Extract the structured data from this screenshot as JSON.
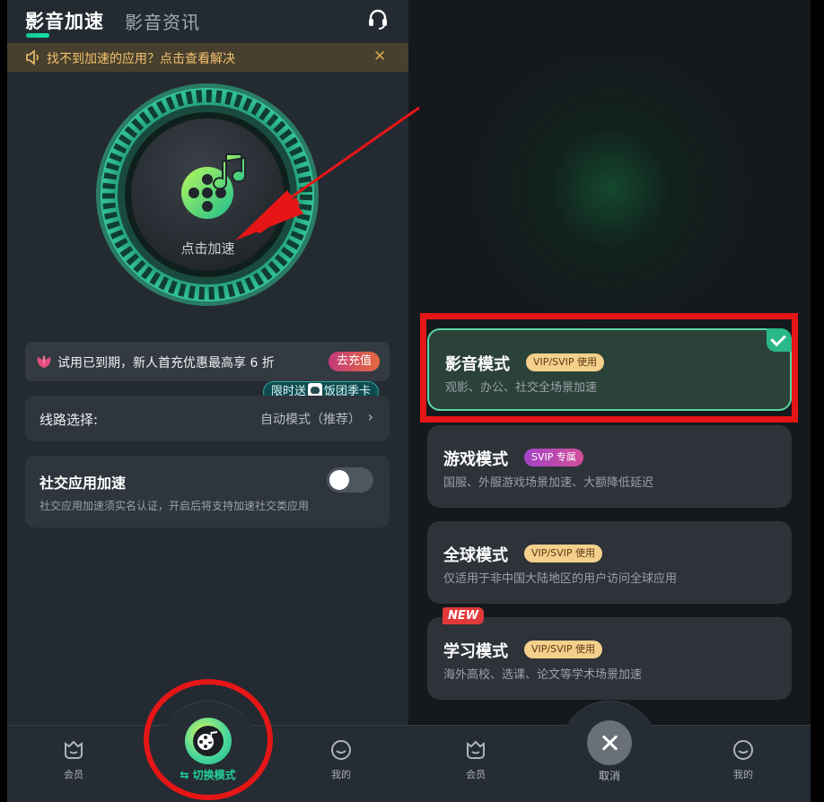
{
  "left": {
    "header": {
      "active_tab": "影音加速",
      "other_tab": "影音资讯",
      "support_icon": "headset-icon"
    },
    "notice": {
      "text": "找不到加速的应用？点击查看解决",
      "close": "✕"
    },
    "dial": {
      "label": "点击加速"
    },
    "trial": {
      "text": "试用已到期，新人首充优惠最高享 6 折",
      "button": "去充值",
      "promo_prefix": "限时送",
      "promo_suffix": "饭团季卡"
    },
    "route": {
      "label": "线路选择:",
      "value": "自动模式（推荐）",
      "chevron": "›"
    },
    "social": {
      "title": "社交应用加速",
      "subtitle": "社交应用加速须实名认证，开启后将支持加速社交类应用",
      "toggle_on": false
    },
    "nav": {
      "member": "会员",
      "switch_mode": "⇆ 切换模式",
      "mine": "我的"
    }
  },
  "right": {
    "modes": [
      {
        "title": "影音模式",
        "badge": "VIP/SVIP 使用",
        "subtitle": "观影、办公、社交全场景加速",
        "selected": true
      },
      {
        "title": "游戏模式",
        "badge": "SVIP 专属",
        "subtitle": "国服、外服游戏场景加速、大额降低延迟",
        "selected": false
      },
      {
        "title": "全球模式",
        "badge": "VIP/SVIP 使用",
        "subtitle": "仅适用于非中国大陆地区的用户访问全球应用",
        "selected": false
      },
      {
        "title": "学习模式",
        "badge": "VIP/SVIP 使用",
        "subtitle": "海外高校、选课、论文等学术场景加速",
        "selected": false
      }
    ],
    "new_tag": "NEW",
    "nav": {
      "member": "会员",
      "cancel": "取消",
      "mine": "我的"
    }
  },
  "colors": {
    "accent": "#1fd39a",
    "annotation_red": "#e61616",
    "vip_badge": "#f3d08b"
  }
}
